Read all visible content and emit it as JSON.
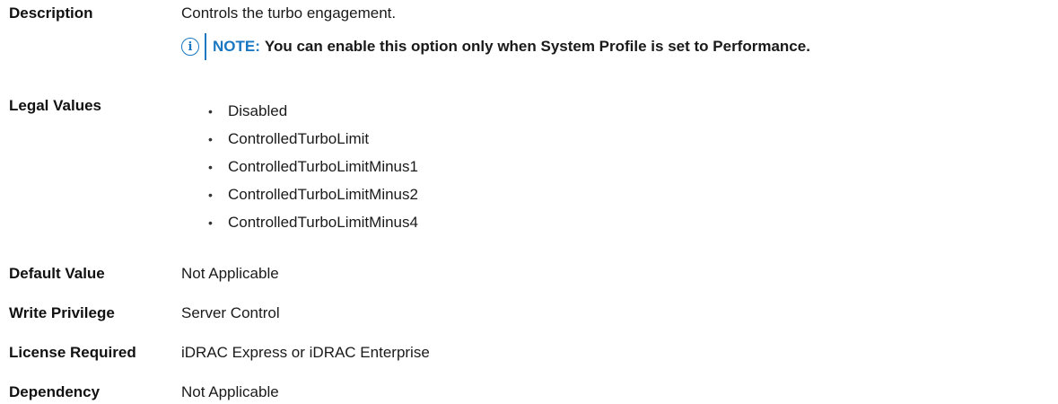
{
  "description": {
    "label": "Description",
    "text": "Controls the turbo engagement.",
    "note": {
      "icon": "info-icon",
      "label": "NOTE:",
      "text": "You can enable this option only when System Profile is set to Performance."
    }
  },
  "legal_values": {
    "label": "Legal Values",
    "items": [
      "Disabled",
      "ControlledTurboLimit",
      "ControlledTurboLimitMinus1",
      "ControlledTurboLimitMinus2",
      "ControlledTurboLimitMinus4"
    ]
  },
  "default_value": {
    "label": "Default Value",
    "text": "Not Applicable"
  },
  "write_privilege": {
    "label": "Write Privilege",
    "text": "Server Control"
  },
  "license_required": {
    "label": "License Required",
    "text": "iDRAC Express or iDRAC Enterprise"
  },
  "dependency": {
    "label": "Dependency",
    "text": "Not Applicable"
  },
  "colors": {
    "accent": "#1a78c2",
    "text": "#1a1a1a"
  }
}
